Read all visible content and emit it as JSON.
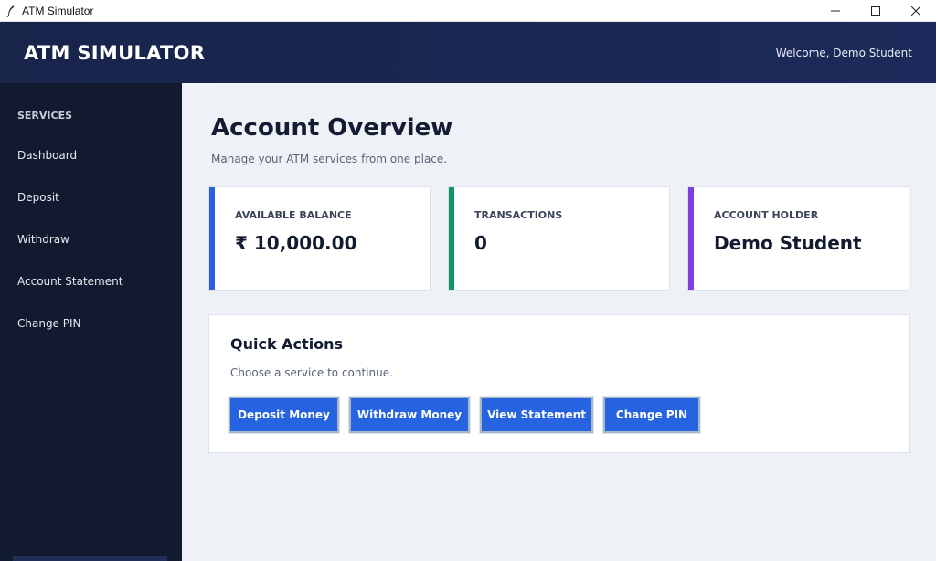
{
  "window": {
    "title": "ATM Simulator",
    "controls": [
      "minimize-icon",
      "maximize-icon",
      "close-icon"
    ]
  },
  "header": {
    "brand": "ATM SIMULATOR",
    "welcome": "Welcome, Demo Student"
  },
  "sidebar": {
    "heading": "SERVICES",
    "items": [
      {
        "label": "Dashboard"
      },
      {
        "label": "Deposit"
      },
      {
        "label": "Withdraw"
      },
      {
        "label": "Account Statement"
      },
      {
        "label": "Change PIN"
      }
    ]
  },
  "main": {
    "title": "Account Overview",
    "subtitle": "Manage your ATM services from one place.",
    "cards": [
      {
        "label": "AVAILABLE BALANCE",
        "value": "₹ 10,000.00",
        "accent": "#2f5fe0"
      },
      {
        "label": "TRANSACTIONS",
        "value": "0",
        "accent": "#149366"
      },
      {
        "label": "ACCOUNT HOLDER",
        "value": "Demo Student",
        "accent": "#7c3fe4"
      }
    ],
    "quick_actions": {
      "title": "Quick Actions",
      "subtitle": "Choose a service to continue.",
      "buttons": [
        {
          "label": "Deposit Money"
        },
        {
          "label": "Withdraw Money"
        },
        {
          "label": "View Statement"
        },
        {
          "label": "Change PIN"
        }
      ]
    }
  },
  "colors": {
    "header_bg": "#1b2a5a",
    "sidebar_bg": "#111a2e",
    "primary_button": "#2563e0",
    "page_bg": "#eef1f5"
  }
}
